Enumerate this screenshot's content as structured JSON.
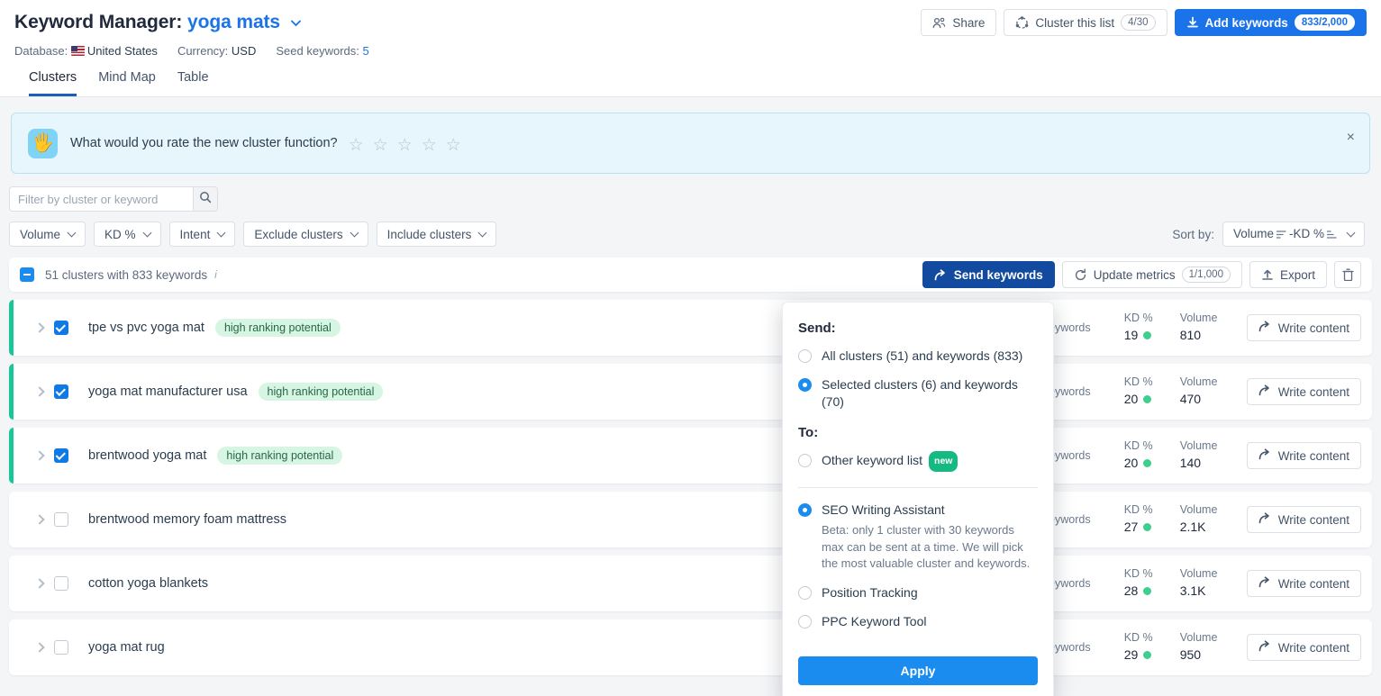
{
  "header": {
    "title_prefix": "Keyword Manager:",
    "keyword": "yoga mats",
    "share_label": "Share",
    "cluster_list_label": "Cluster this list",
    "cluster_list_count": "4/30",
    "add_keywords_label": "Add keywords",
    "add_keywords_count": "833/2,000",
    "meta": {
      "database_label": "Database:",
      "database_value": "United States",
      "currency_label": "Currency:",
      "currency_value": "USD",
      "seed_label": "Seed keywords:",
      "seed_value": "5"
    }
  },
  "tabs": [
    {
      "label": "Clusters",
      "active": true
    },
    {
      "label": "Mind Map",
      "active": false
    },
    {
      "label": "Table",
      "active": false
    }
  ],
  "banner": {
    "icon": "waving-hand",
    "text": "What would you rate the new cluster function?",
    "stars": 5,
    "stars_filled": 0,
    "close": "×"
  },
  "filters": {
    "search_placeholder": "Filter by cluster or keyword",
    "search_value": "",
    "search_icon": "search-icon",
    "buttons": [
      "Volume",
      "KD %",
      "Intent",
      "Exclude clusters",
      "Include clusters"
    ],
    "sort_label": "Sort by:",
    "sort_value": "Volume",
    "sort_separator": "-",
    "sort_value2": "KD %"
  },
  "toolbar": {
    "summary": "51 clusters with 833 keywords",
    "info_icon": "info-icon",
    "send_keywords_label": "Send keywords",
    "update_metrics_label": "Update metrics",
    "update_metrics_count": "1/1,000",
    "export_label": "Export",
    "delete_icon": "trash-icon"
  },
  "clusters": [
    {
      "name": "tpe vs pvc yoga mat",
      "tag": "high ranking potential",
      "selected": true,
      "keywords_label": "Keywords",
      "keywords_value": "",
      "kd_label": "KD %",
      "kd_value": "19",
      "volume_label": "Volume",
      "volume_value": "810",
      "write_label": "Write content"
    },
    {
      "name": "yoga mat manufacturer usa",
      "tag": "high ranking potential",
      "selected": true,
      "keywords_label": "Keywords",
      "keywords_value": "",
      "kd_label": "KD %",
      "kd_value": "20",
      "volume_label": "Volume",
      "volume_value": "470",
      "write_label": "Write content"
    },
    {
      "name": "brentwood yoga mat",
      "tag": "high ranking potential",
      "selected": true,
      "keywords_label": "Keywords",
      "keywords_value": "",
      "kd_label": "KD %",
      "kd_value": "20",
      "volume_label": "Volume",
      "volume_value": "140",
      "write_label": "Write content"
    },
    {
      "name": "brentwood memory foam mattress",
      "tag": "",
      "selected": false,
      "keywords_label": "Keywords",
      "keywords_value": "",
      "kd_label": "KD %",
      "kd_value": "27",
      "volume_label": "Volume",
      "volume_value": "2.1K",
      "write_label": "Write content"
    },
    {
      "name": "cotton yoga blankets",
      "tag": "",
      "selected": false,
      "keywords_label": "Keywords",
      "keywords_value": "",
      "kd_label": "KD %",
      "kd_value": "28",
      "volume_label": "Volume",
      "volume_value": "3.1K",
      "write_label": "Write content"
    },
    {
      "name": "yoga mat rug",
      "tag": "",
      "selected": false,
      "keywords_label": "Keywords",
      "keywords_value": "",
      "kd_label": "KD %",
      "kd_value": "29",
      "volume_label": "Volume",
      "volume_value": "950",
      "write_label": "Write content"
    }
  ],
  "send_dropdown": {
    "send_heading": "Send:",
    "option_all": "All clusters (51) and keywords (833)",
    "option_selected": "Selected clusters (6) and keywords (70)",
    "to_heading": "To:",
    "option_other_list": "Other keyword list",
    "other_list_badge": "new",
    "option_swa": "SEO Writing Assistant",
    "swa_description": "Beta: only 1 cluster with 30 keywords max can be sent at a time. We will pick the most valuable cluster and keywords.",
    "option_position_tracking": "Position Tracking",
    "option_ppc": "PPC Keyword Tool",
    "apply_label": "Apply"
  },
  "colors": {
    "brand_blue": "#1a73e8",
    "dark_blue": "#114a9e",
    "accent_green": "#17c79a",
    "tag_bg": "#d7f5e3",
    "banner_bg": "#e7f5fd",
    "badge_new": "#16b981"
  }
}
